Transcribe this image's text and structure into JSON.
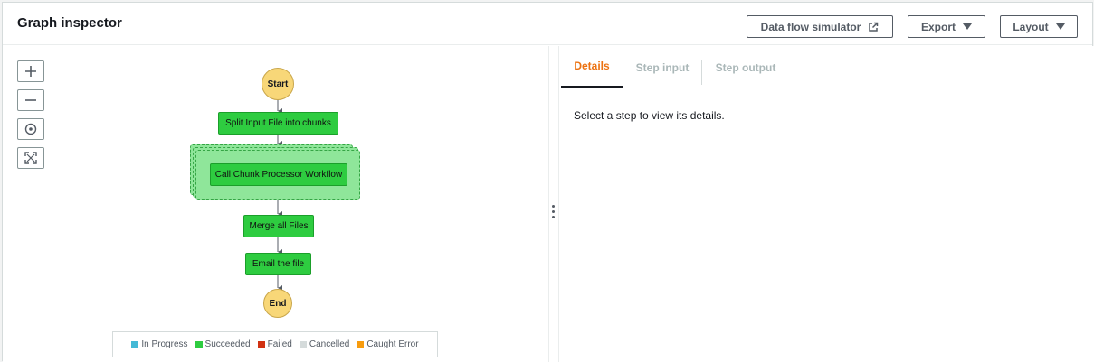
{
  "header": {
    "title": "Graph inspector",
    "buttons": {
      "simulator": "Data flow simulator",
      "export": "Export",
      "layout": "Layout"
    }
  },
  "zoom_controls": [
    "zoom-in",
    "zoom-out",
    "center",
    "fit"
  ],
  "graph": {
    "start": "Start",
    "end": "End",
    "steps": {
      "split": "Split Input File into chunks",
      "map": "Call Chunk Processor Workflow",
      "merge": "Merge all Files",
      "email": "Email the file"
    }
  },
  "legend": [
    {
      "label": "In Progress",
      "color": "#44b9d6"
    },
    {
      "label": "Succeeded",
      "color": "#2ecc40"
    },
    {
      "label": "Failed",
      "color": "#d13212"
    },
    {
      "label": "Cancelled",
      "color": "#d5dbdb"
    },
    {
      "label": "Caught Error",
      "color": "#f89c0e"
    }
  ],
  "details": {
    "tabs": [
      "Details",
      "Step input",
      "Step output"
    ],
    "active_tab": "Details",
    "message": "Select a step to view its details."
  }
}
